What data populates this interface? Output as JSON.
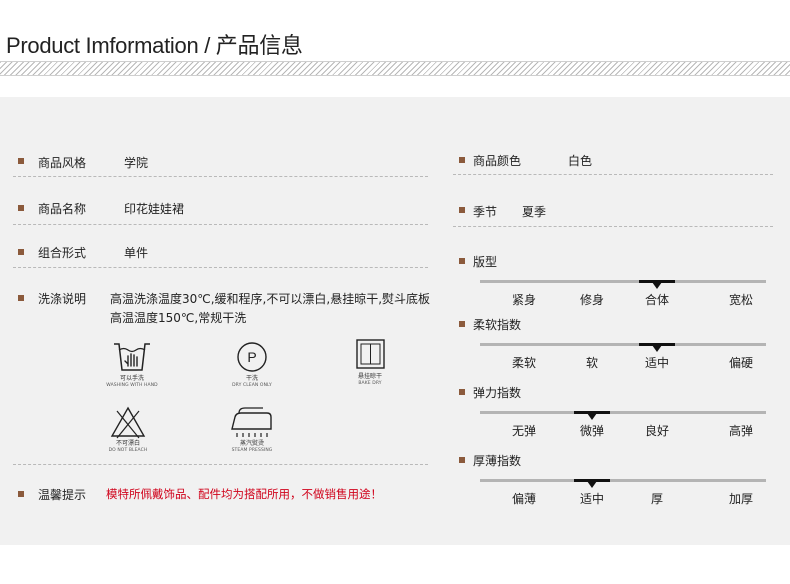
{
  "header": {
    "title": "Product Imformation / 产品信息"
  },
  "left": {
    "style": {
      "key": "商品风格",
      "value": "学院"
    },
    "name": {
      "key": "商品名称",
      "value": "印花娃娃裙"
    },
    "combo": {
      "key": "组合形式",
      "value": "单件"
    },
    "wash": {
      "key": "洗涤说明",
      "text": "高温洗涤温度30℃,缓和程序,不可以漂白,悬挂晾干,熨斗底板高温温度150℃,常规干洗"
    },
    "care_icons": [
      {
        "icon": "hand-wash-icon",
        "cn": "可以手洗",
        "en": "WASHING WITH HAND"
      },
      {
        "icon": "dry-clean-icon",
        "cn": "干洗",
        "en": "DRY CLEAN ONLY",
        "symbol": "P"
      },
      {
        "icon": "hang-dry-icon",
        "cn": "悬挂晾干",
        "en": "BAKE DRY"
      },
      {
        "icon": "no-bleach-icon",
        "cn": "不可漂白",
        "en": "DO NOT BLEACH"
      },
      {
        "icon": "steam-iron-icon",
        "cn": "蒸汽熨烫",
        "en": "STEAM PRESSING"
      }
    ],
    "notice": {
      "key": "温馨提示",
      "text": "模特所佩戴饰品、配件均为搭配所用，不做销售用途！"
    }
  },
  "right": {
    "color": {
      "key": "商品颜色",
      "value": "白色"
    },
    "season": {
      "key": "季节",
      "value": "夏季"
    },
    "scales": [
      {
        "key": "版型",
        "labels": [
          "紧身",
          "修身",
          "合体",
          "宽松"
        ],
        "selected": 2
      },
      {
        "key": "柔软指数",
        "labels": [
          "柔软",
          "软",
          "适中",
          "偏硬"
        ],
        "selected": 2
      },
      {
        "key": "弹力指数",
        "labels": [
          "无弹",
          "微弹",
          "良好",
          "高弹"
        ],
        "selected": 1
      },
      {
        "key": "厚薄指数",
        "labels": [
          "偏薄",
          "适中",
          "厚",
          "加厚"
        ],
        "selected": 1
      }
    ]
  },
  "colors": {
    "bullet": "#8b5a3c",
    "notice": "#d0021b",
    "panel": "#f1f1f1"
  }
}
